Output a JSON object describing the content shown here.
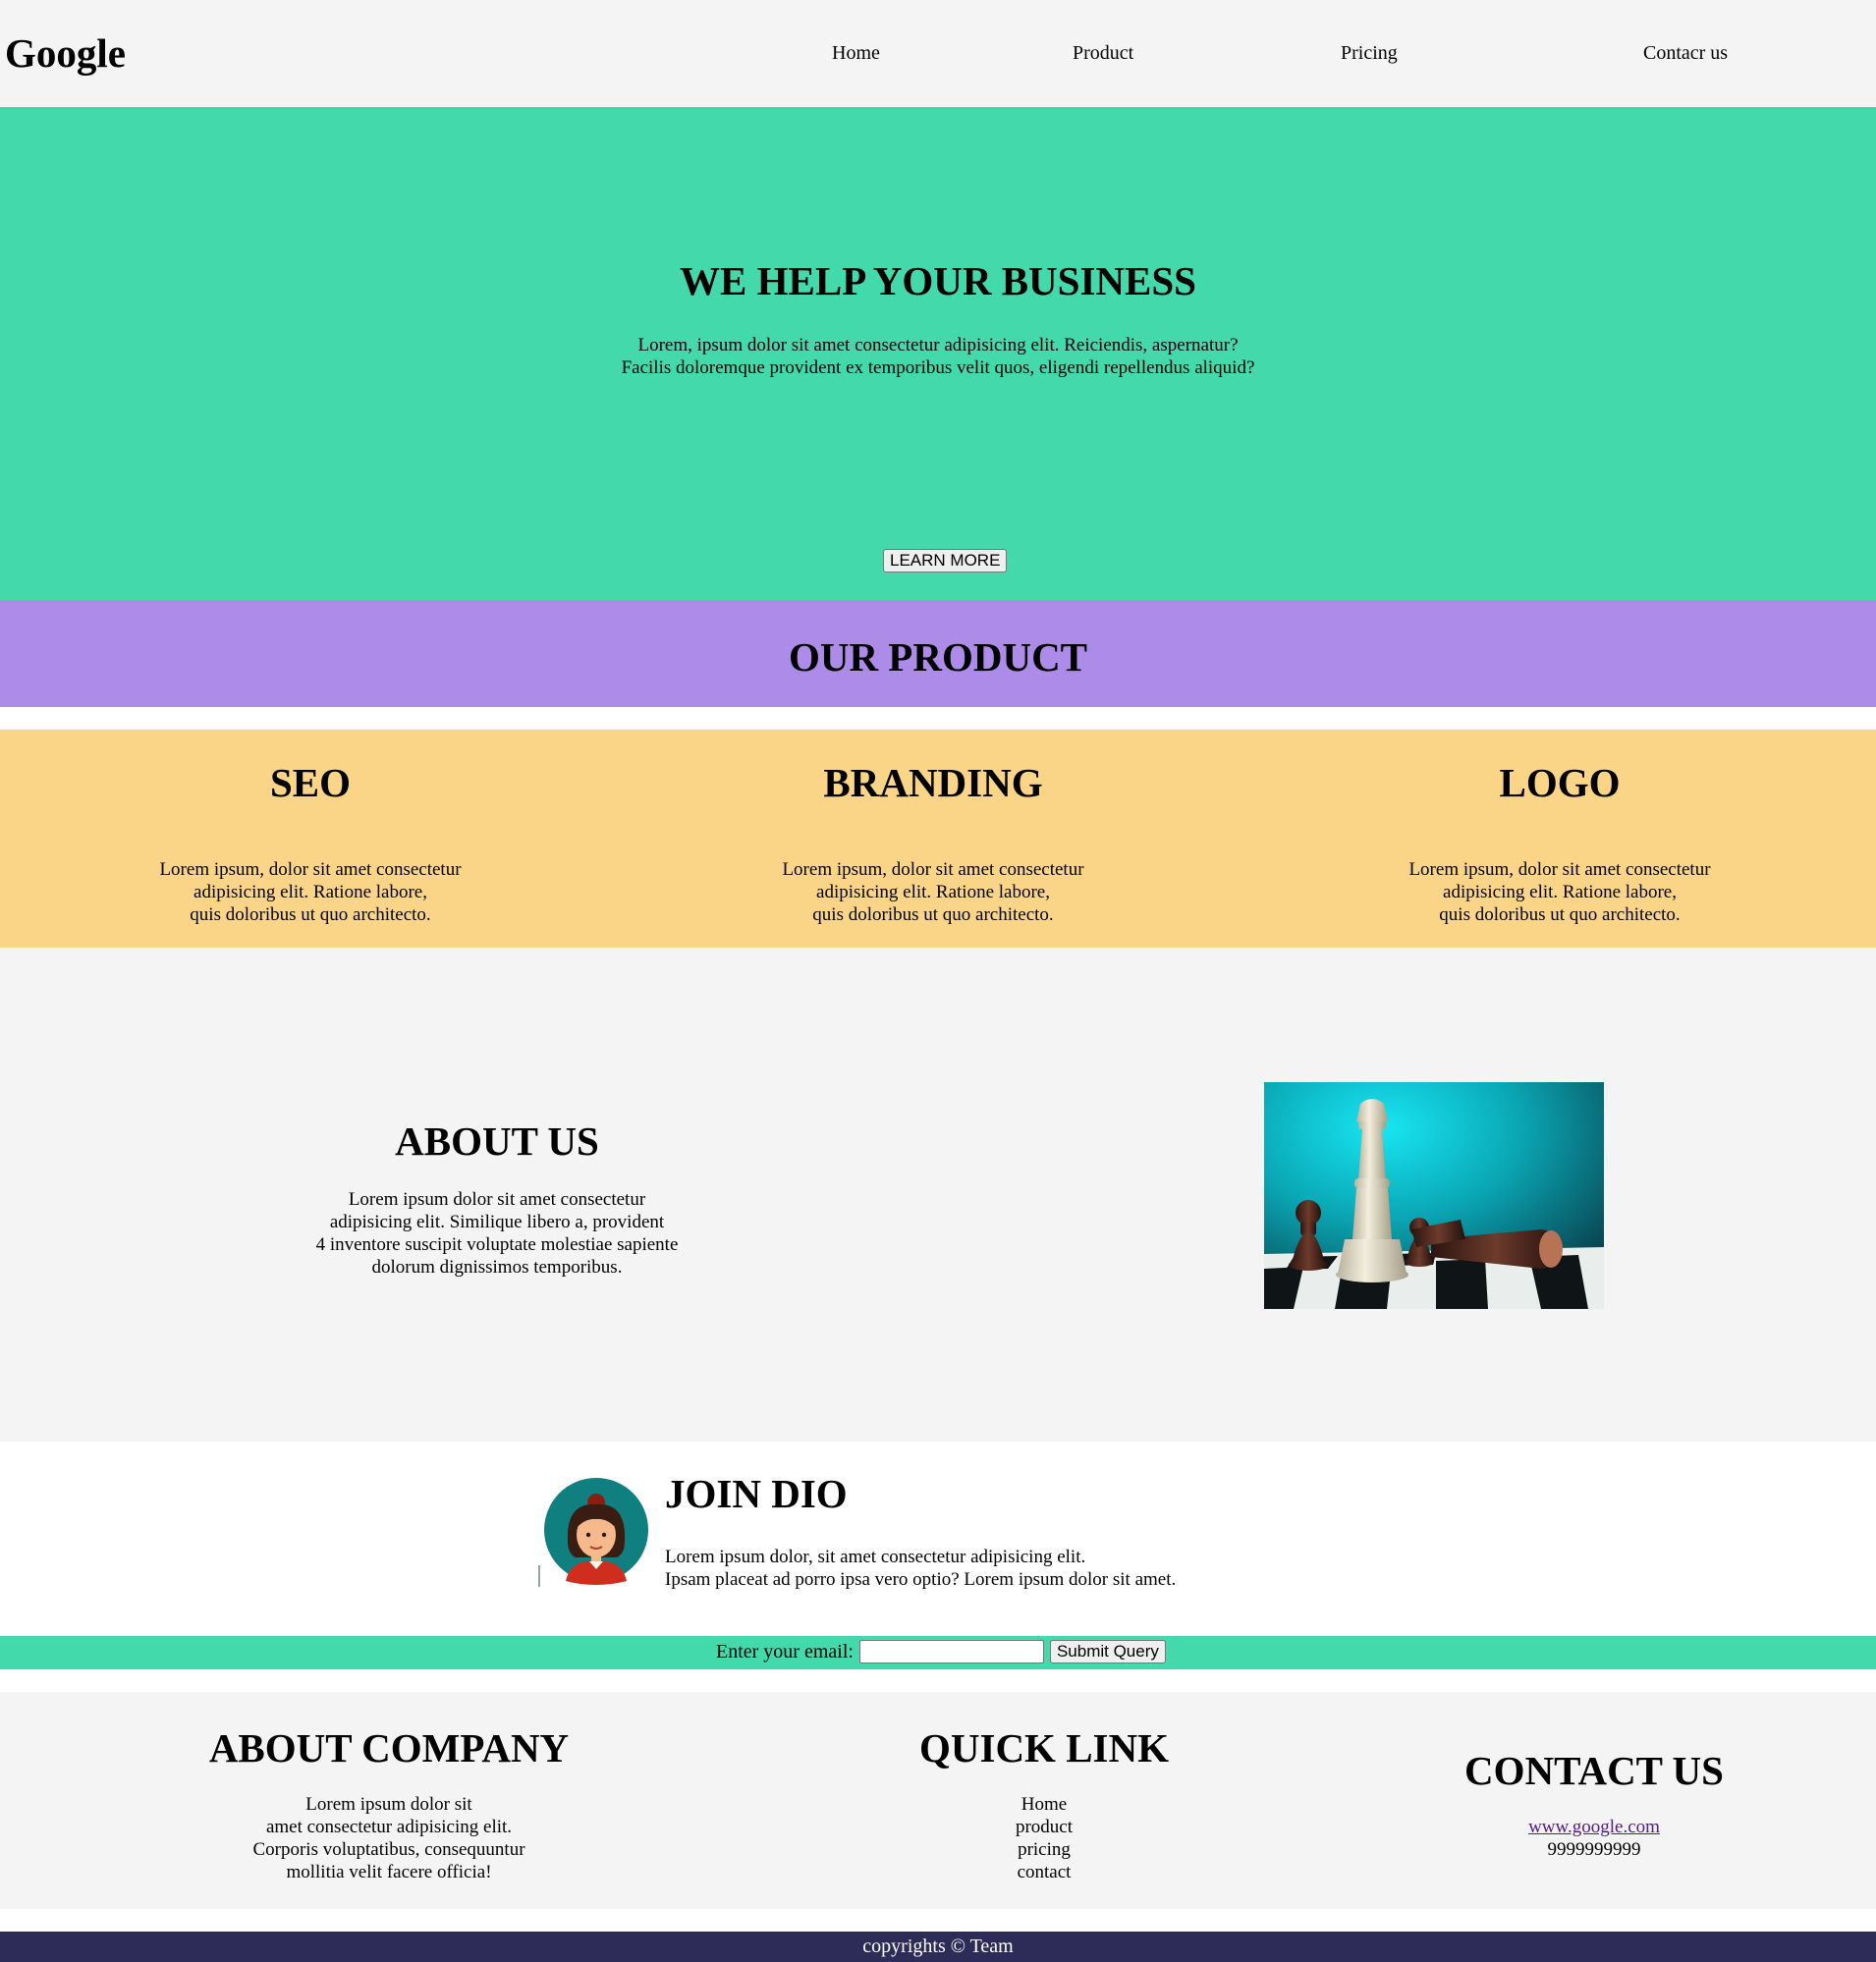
{
  "nav": {
    "logo": "Google",
    "links": [
      "Home",
      "Product",
      "Pricing",
      "Contacr us"
    ]
  },
  "hero": {
    "title": "WE HELP YOUR BUSINESS",
    "line1": "Lorem, ipsum dolor sit amet consectetur adipisicing elit. Reiciendis, aspernatur?",
    "line2": "Facilis doloremque provident ex temporibus velit quos, eligendi repellendus aliquid?",
    "button": "LEARN MORE"
  },
  "product_banner": {
    "title": "OUR PRODUCT"
  },
  "features": [
    {
      "title": "SEO",
      "lines": [
        "Lorem ipsum, dolor sit amet consectetur",
        "adipisicing elit. Ratione labore,",
        "quis doloribus ut quo architecto."
      ]
    },
    {
      "title": "BRANDING",
      "lines": [
        "Lorem ipsum, dolor sit amet consectetur",
        "adipisicing elit. Ratione labore,",
        "quis doloribus ut quo architecto."
      ]
    },
    {
      "title": "LOGO",
      "lines": [
        "Lorem ipsum, dolor sit amet consectetur",
        "adipisicing elit. Ratione labore,",
        "quis doloribus ut quo architecto."
      ]
    }
  ],
  "about": {
    "title": "ABOUT US",
    "lines": [
      "Lorem ipsum dolor sit amet consectetur",
      "adipisicing elit. Similique libero a, provident",
      "4 inventore suscipit voluptate molestiae sapiente",
      "dolorum dignissimos temporibus."
    ]
  },
  "join": {
    "title": "JOIN DIO",
    "line1": "Lorem ipsum dolor, sit amet consectetur adipisicing elit.",
    "line2": "Ipsam placeat ad porro ipsa vero optio? Lorem ipsum dolor sit amet."
  },
  "newsletter": {
    "label": "Enter your email:",
    "value": "",
    "button": "Submit Query"
  },
  "footer": {
    "company": {
      "title": "ABOUT COMPANY",
      "lines": [
        "Lorem ipsum dolor sit",
        "amet consectetur adipisicing elit.",
        "Corporis voluptatibus, consequuntur",
        "mollitia velit facere officia!"
      ]
    },
    "quick": {
      "title": "QUICK LINK",
      "links": [
        "Home",
        "product",
        "pricing",
        "contact"
      ]
    },
    "contact": {
      "title": "CONTACT US",
      "website": "www.google.com",
      "phone": "9999999999"
    }
  },
  "copyright": "copyrights © Team",
  "colors": {
    "nav_bg": "#f4f4f4",
    "hero_bg": "#43d9ab",
    "product_bg": "#ad8ce9",
    "features_bg": "#fad588",
    "footer_bottom_bg": "#2d2b58"
  }
}
